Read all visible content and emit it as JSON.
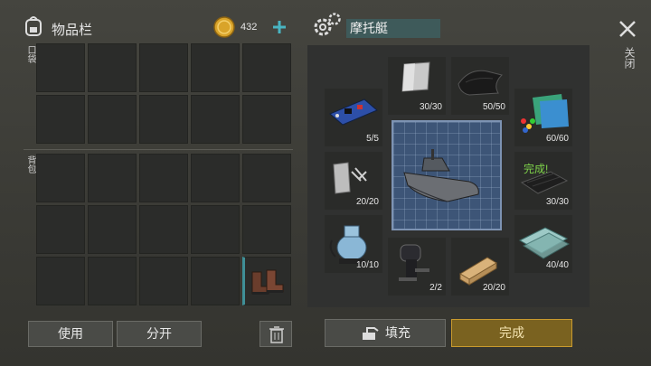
{
  "inventory": {
    "title": "物品栏",
    "pocket_label": "口袋",
    "backpack_label": "背包",
    "coins": "432"
  },
  "buttons": {
    "use": "使用",
    "split": "分开",
    "fill": "填充",
    "complete": "完成",
    "close": "关闭"
  },
  "craft": {
    "title": "摩托艇",
    "slots": {
      "steel": "30/30",
      "cloth": "50/50",
      "circuit": "5/5",
      "plastic": "60/60",
      "scrap": "20/20",
      "carbon": "30/30",
      "carbon_done": "完成!",
      "pump": "10/10",
      "glass": "40/40",
      "engine": "2/2",
      "wood": "20/20"
    }
  },
  "icons": [
    "backpack-icon",
    "coin-icon",
    "plus-icon",
    "gear-icon",
    "trash-icon",
    "close-icon",
    "fill-icon"
  ],
  "colors": {
    "accent": "#c99a2e",
    "title_box": "#3e5a5a",
    "complete": "#7a6220"
  }
}
